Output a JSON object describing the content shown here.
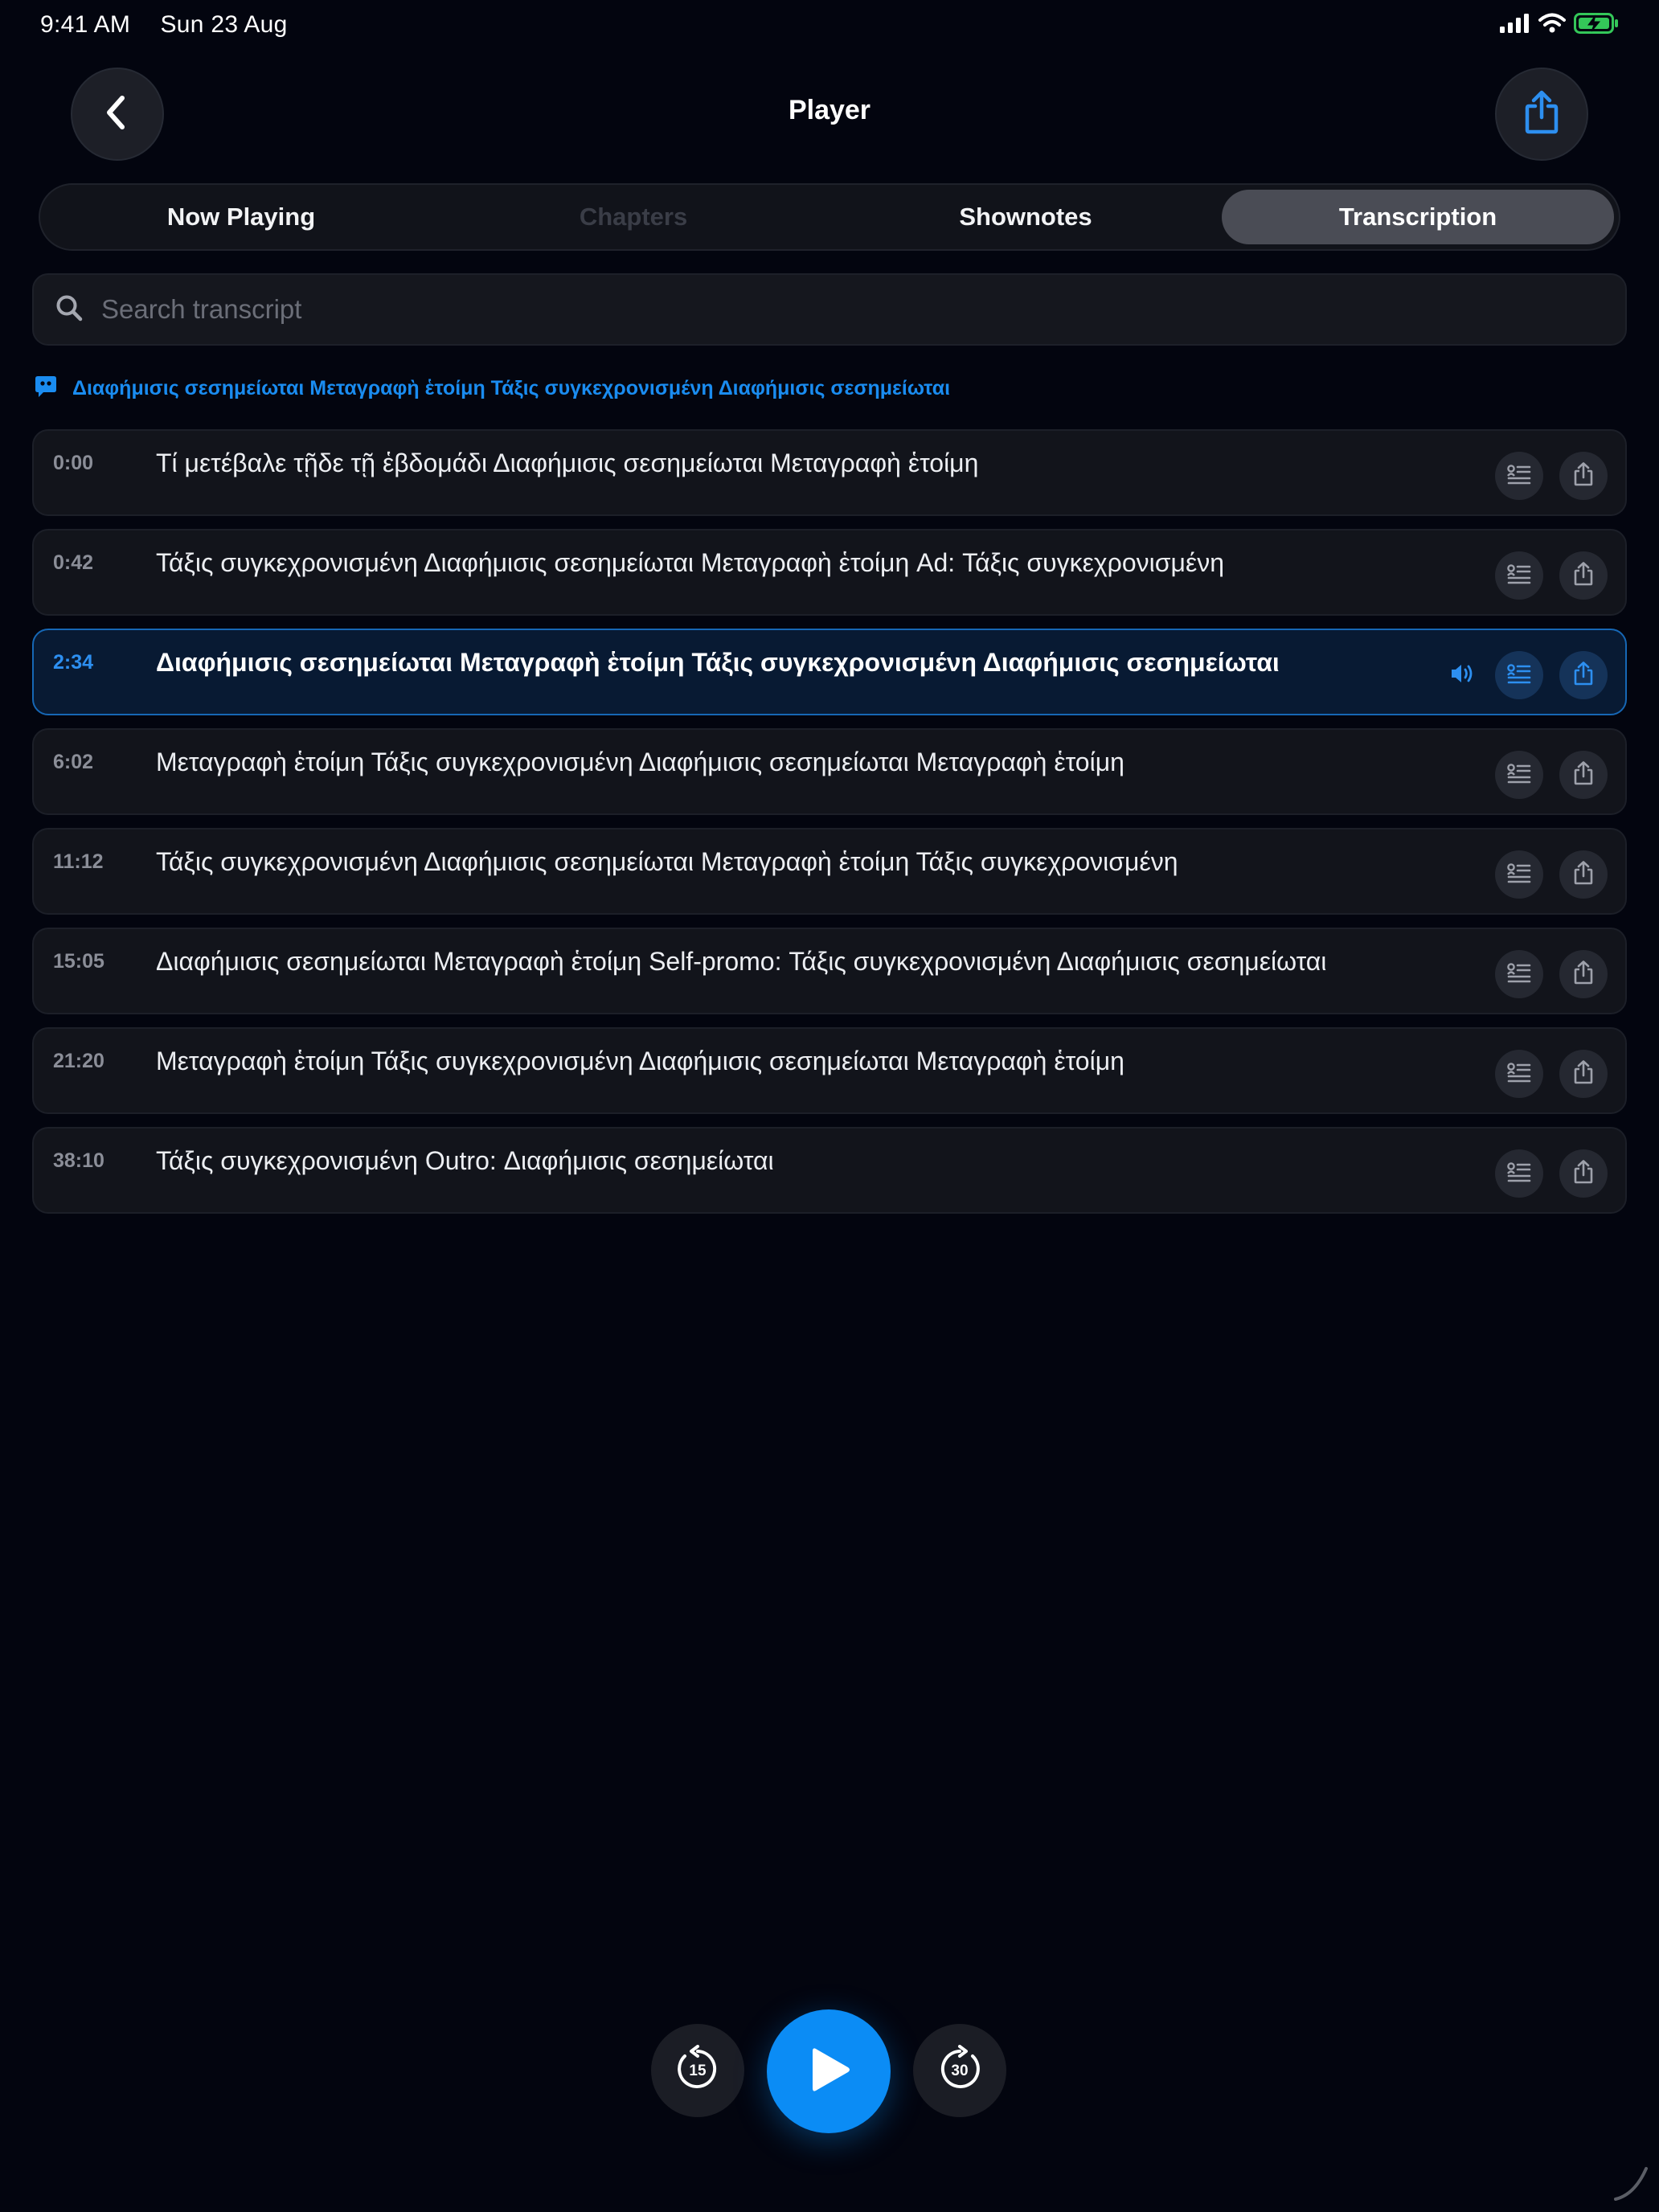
{
  "status_bar": {
    "time": "9:41 AM",
    "date": "Sun 23 Aug",
    "icons": [
      "signal-icon",
      "wifi-icon",
      "battery-charging-icon"
    ]
  },
  "header": {
    "title": "Player",
    "back_icon": "chevron-left-icon",
    "share_icon": "share-icon"
  },
  "tabs": [
    {
      "label": "Now Playing",
      "state": "normal"
    },
    {
      "label": "Chapters",
      "state": "disabled"
    },
    {
      "label": "Shownotes",
      "state": "normal"
    },
    {
      "label": "Transcription",
      "state": "selected"
    }
  ],
  "search": {
    "placeholder": "Search transcript"
  },
  "now_speaking": {
    "text": "Διαφήμισις σεσημείωται Μεταγραφὴ ἑτοίμη Τάξις συγκεχρονισμένη Διαφήμισις σεσημείωται"
  },
  "segments": [
    {
      "time": "0:00",
      "text": "Τί μετέβαλε τῇδε τῇ ἑβδομάδι Διαφήμισις σεσημείωται Μεταγραφὴ ἑτοίμη",
      "active": false
    },
    {
      "time": "0:42",
      "text": "Τάξις συγκεχρονισμένη Διαφήμισις σεσημείωται Μεταγραφὴ ἑτοίμη Ad: Τάξις συγκεχρονισμένη",
      "active": false
    },
    {
      "time": "2:34",
      "text": "Διαφήμισις σεσημείωται Μεταγραφὴ ἑτοίμη Τάξις συγκεχρονισμένη Διαφήμισις σεσημείωται",
      "active": true
    },
    {
      "time": "6:02",
      "text": "Μεταγραφὴ ἑτοίμη Τάξις συγκεχρονισμένη Διαφήμισις σεσημείωται Μεταγραφὴ ἑτοίμη",
      "active": false
    },
    {
      "time": "11:12",
      "text": "Τάξις συγκεχρονισμένη Διαφήμισις σεσημείωται Μεταγραφὴ ἑτοίμη Τάξις συγκεχρονισμένη",
      "active": false
    },
    {
      "time": "15:05",
      "text": "Διαφήμισις σεσημείωται Μεταγραφὴ ἑτοίμη Self-promo: Τάξις συγκεχρονισμένη Διαφήμισις σεσημείωται",
      "active": false
    },
    {
      "time": "21:20",
      "text": "Μεταγραφὴ ἑτοίμη Τάξις συγκεχρονισμένη Διαφήμισις σεσημείωται Μεταγραφὴ ἑτοίμη",
      "active": false
    },
    {
      "time": "38:10",
      "text": "Τάξις συγκεχρονισμένη Outro: Διαφήμισις σεσημείωται",
      "active": false
    }
  ],
  "controls": {
    "skip_back_seconds": "15",
    "skip_forward_seconds": "30",
    "play_icon": "play-icon"
  },
  "colors": {
    "background": "#03050f",
    "accent": "#0b8cf5",
    "active_row": "#081a33",
    "battery": "#34c759"
  }
}
